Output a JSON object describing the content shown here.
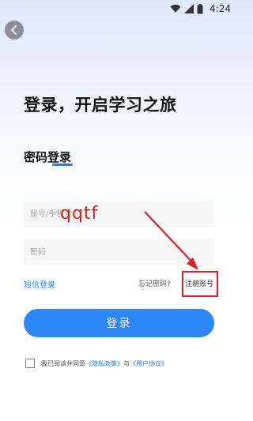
{
  "status_bar": {
    "time": "4:24"
  },
  "page": {
    "headline": "登录，开启学习之旅",
    "tab_title": "密码登录"
  },
  "form": {
    "account_placeholder": "账号/手机号",
    "password_placeholder": "密码"
  },
  "links": {
    "sms_login": "短信登录",
    "forgot_password": "忘记密码?",
    "register": "注册账号"
  },
  "login_button_label": "登录",
  "agreement": {
    "prefix": "我已阅读并同意",
    "privacy_policy": "《隐私政策》",
    "and": "与",
    "user_agreement": "《用户协议》"
  },
  "annotation": {
    "watermark_text": "qqtf",
    "highlight_color": "#e02020"
  },
  "colors": {
    "accent": "#2f86f7",
    "link": "#2a7ef5"
  }
}
